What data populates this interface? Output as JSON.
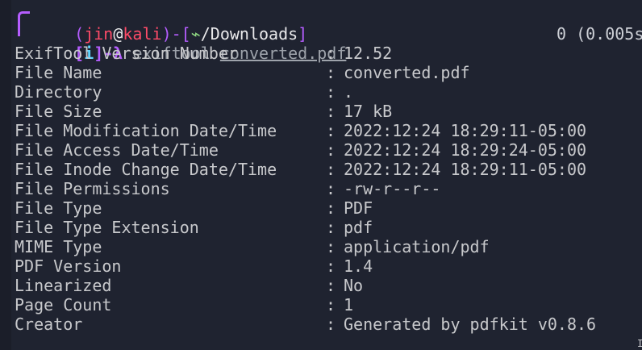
{
  "prompt": {
    "open": "(",
    "user": "jin",
    "at": "@",
    "host": "kali",
    "close": ")",
    "dash": "-",
    "dir_open": "[",
    "dir_symbol": "⌁",
    "dir_path": "/Downloads",
    "dir_close": "]",
    "info_open": "[",
    "info_flag": "i",
    "info_close": "]",
    "arrow": "-λ",
    "command": "exiftool",
    "argument": "converted.pdf"
  },
  "timing": "0 (0.005s",
  "output": [
    {
      "key": "ExifTool Version Number",
      "value": "12.52"
    },
    {
      "key": "File Name",
      "value": "converted.pdf"
    },
    {
      "key": "Directory",
      "value": "."
    },
    {
      "key": "File Size",
      "value": "17 kB"
    },
    {
      "key": "File Modification Date/Time",
      "value": "2022:12:24 18:29:11-05:00"
    },
    {
      "key": "File Access Date/Time",
      "value": "2022:12:24 18:29:24-05:00"
    },
    {
      "key": "File Inode Change Date/Time",
      "value": "2022:12:24 18:29:11-05:00"
    },
    {
      "key": "File Permissions",
      "value": "-rw-r--r--"
    },
    {
      "key": "File Type",
      "value": "PDF"
    },
    {
      "key": "File Type Extension",
      "value": "pdf"
    },
    {
      "key": "MIME Type",
      "value": "application/pdf"
    },
    {
      "key": "PDF Version",
      "value": "1.4"
    },
    {
      "key": "Linearized",
      "value": "No"
    },
    {
      "key": "Page Count",
      "value": "1"
    },
    {
      "key": "Creator",
      "value": "Generated by pdfkit v0.8.6"
    }
  ],
  "separator": ":",
  "cursor_glyph": "I",
  "colors": {
    "background": "#1f2330",
    "text": "#c8c9cc",
    "prompt_purple": "#b55dff",
    "prompt_red": "#ff4b68",
    "accent_green": "#8fd982"
  }
}
